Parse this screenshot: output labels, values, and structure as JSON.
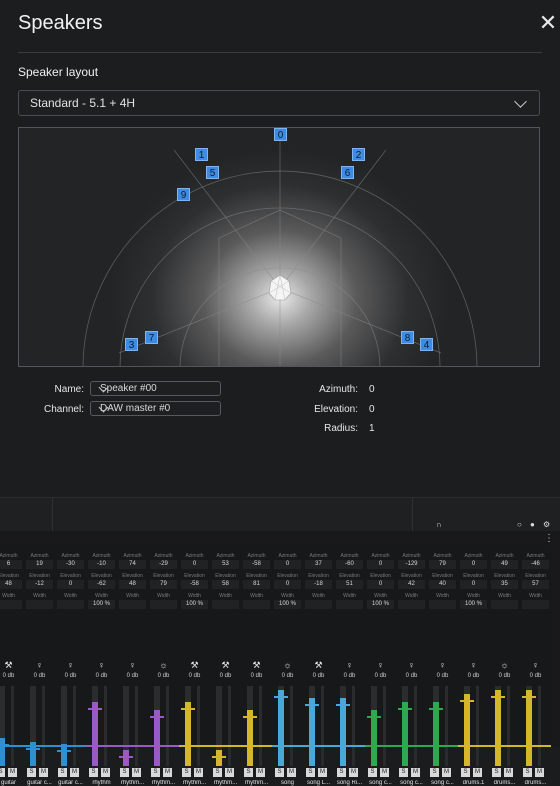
{
  "dialog": {
    "title": "Speakers",
    "close_symbol": "✕"
  },
  "layout": {
    "label": "Speaker layout",
    "selected": "Standard - 5.1 + 4H"
  },
  "speakers": [
    "0",
    "1",
    "2",
    "3",
    "4",
    "5",
    "6",
    "7",
    "8",
    "9"
  ],
  "properties": {
    "name_label": "Name:",
    "name_value": "Speaker #00",
    "channel_label": "Channel:",
    "channel_value": "DAW master #0",
    "azimuth_label": "Azimuth:",
    "azimuth_value": "0",
    "elevation_label": "Elevation:",
    "elevation_value": "0",
    "radius_label": "Radius:",
    "radius_value": "1"
  },
  "mixer": {
    "azimuth_label": "Azimuth",
    "elevation_label": "Elevation",
    "width_label": "Width",
    "db_value": "0 db",
    "solo_label": "S",
    "mute_label": "M",
    "menu_symbol": "⋮",
    "channels": [
      {
        "name": "guitar",
        "azimuth": "6",
        "elevation": "48",
        "width": "",
        "icon": "guitar-icon",
        "color": "#2f8fd0",
        "level": 0.35
      },
      {
        "name": "guitar c...",
        "azimuth": "19",
        "elevation": "-12",
        "width": "",
        "icon": "mic-icon",
        "color": "#2f8fd0",
        "level": 0.3
      },
      {
        "name": "guitar c...",
        "azimuth": "-30",
        "elevation": "0",
        "width": "",
        "icon": "mic-icon",
        "color": "#2f8fd0",
        "level": 0.28
      },
      {
        "name": "rhythm",
        "azimuth": "-10",
        "elevation": "-62",
        "width": "100 %",
        "icon": "mic-icon",
        "color": "#9b59c6",
        "level": 0.8
      },
      {
        "name": "rhythm...",
        "azimuth": "74",
        "elevation": "48",
        "width": "",
        "icon": "mic-icon",
        "color": "#9b59c6",
        "level": 0.2
      },
      {
        "name": "rhythm...",
        "azimuth": "-29",
        "elevation": "79",
        "width": "",
        "icon": "bulb-icon",
        "color": "#9b59c6",
        "level": 0.7
      },
      {
        "name": "rhythm...",
        "azimuth": "0",
        "elevation": "-58",
        "width": "100 %",
        "icon": "guitar-icon",
        "color": "#d4b82a",
        "level": 0.8
      },
      {
        "name": "rhythm...",
        "azimuth": "53",
        "elevation": "58",
        "width": "",
        "icon": "guitar-icon",
        "color": "#d4b82a",
        "level": 0.2
      },
      {
        "name": "rhythm...",
        "azimuth": "-58",
        "elevation": "81",
        "width": "",
        "icon": "guitar-icon",
        "color": "#d4b82a",
        "level": 0.7
      },
      {
        "name": "song",
        "azimuth": "0",
        "elevation": "0",
        "width": "100 %",
        "icon": "bulb-icon",
        "color": "#4aa8d8",
        "level": 0.95
      },
      {
        "name": "song L...",
        "azimuth": "37",
        "elevation": "-18",
        "width": "",
        "icon": "guitar-icon",
        "color": "#4aa8d8",
        "level": 0.85
      },
      {
        "name": "song Ri...",
        "azimuth": "-60",
        "elevation": "51",
        "width": "",
        "icon": "mic-icon",
        "color": "#4aa8d8",
        "level": 0.85
      },
      {
        "name": "song c...",
        "azimuth": "0",
        "elevation": "0",
        "width": "100 %",
        "icon": "mic-icon",
        "color": "#2fa84f",
        "level": 0.7
      },
      {
        "name": "song c...",
        "azimuth": "-129",
        "elevation": "42",
        "width": "",
        "icon": "mic-icon",
        "color": "#2fa84f",
        "level": 0.8
      },
      {
        "name": "song c...",
        "azimuth": "79",
        "elevation": "40",
        "width": "",
        "icon": "mic-icon",
        "color": "#2fa84f",
        "level": 0.8
      },
      {
        "name": "drums.1",
        "azimuth": "0",
        "elevation": "0",
        "width": "100 %",
        "icon": "mic-icon",
        "color": "#d4b82a",
        "level": 0.9
      },
      {
        "name": "drums...",
        "azimuth": "49",
        "elevation": "35",
        "width": "",
        "icon": "bulb-icon",
        "color": "#d4b82a",
        "level": 0.95
      },
      {
        "name": "drums...",
        "azimuth": "-46",
        "elevation": "57",
        "width": "",
        "icon": "mic-icon",
        "color": "#d4b82a",
        "level": 0.95
      }
    ]
  },
  "colors": {
    "speaker": "#3d8be2",
    "accent_border": "#55565a"
  }
}
